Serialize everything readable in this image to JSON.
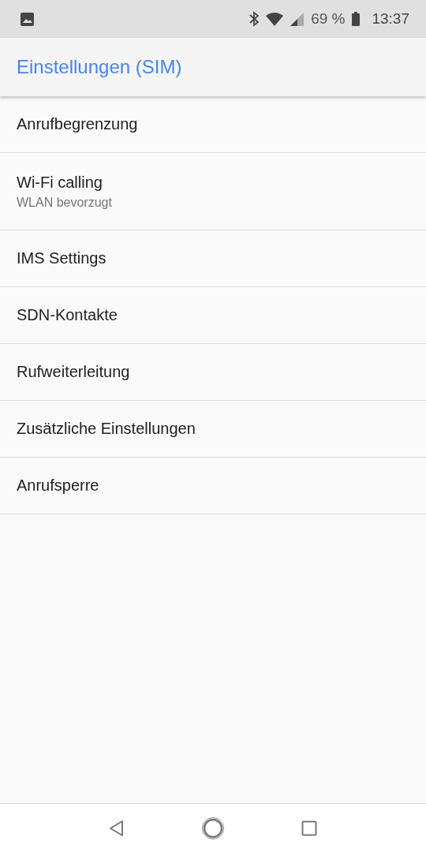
{
  "status_bar": {
    "battery": "69 %",
    "time": "13:37"
  },
  "app_bar": {
    "title": "Einstellungen (SIM)"
  },
  "items": [
    {
      "title": "Anrufbegrenzung"
    },
    {
      "title": "Wi-Fi calling",
      "summary": "WLAN bevorzugt"
    },
    {
      "title": "IMS Settings"
    },
    {
      "title": "SDN-Kontakte"
    },
    {
      "title": "Rufweiterleitung"
    },
    {
      "title": "Zusätzliche Einstellungen"
    },
    {
      "title": "Anrufsperre"
    }
  ]
}
